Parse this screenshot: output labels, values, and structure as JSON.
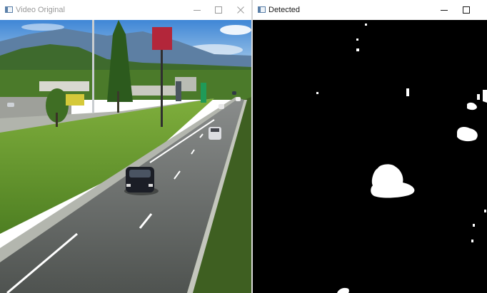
{
  "windows": {
    "original": {
      "title": "Video Original",
      "icon": "app-window-icon",
      "controls": [
        "minimize-icon",
        "maximize-icon",
        "close-icon"
      ]
    },
    "detected": {
      "title": "Detected",
      "icon": "app-window-icon",
      "controls": [
        "minimize-icon",
        "maximize-icon"
      ]
    }
  },
  "colors": {
    "mask_background": "#000000",
    "mask_foreground": "#ffffff",
    "inactive_title": "#9a9a9a",
    "active_title": "#1a1a1a"
  }
}
